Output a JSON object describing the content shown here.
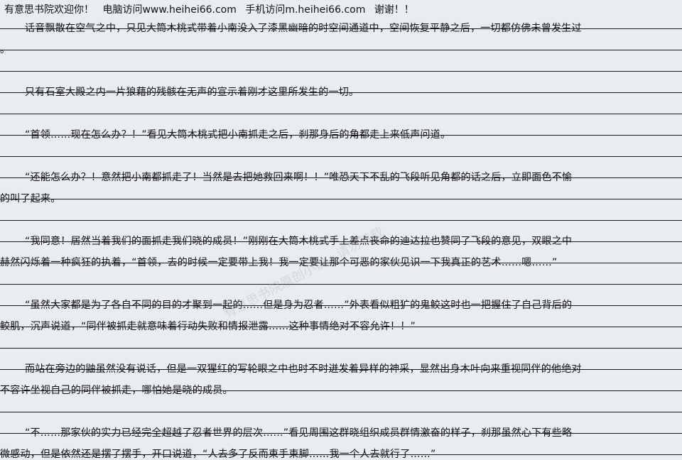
{
  "header": {
    "site": "有意思书院欢迎你！",
    "desktop": "电脑访问www.heihei66.com",
    "mobile": "手机访问m.heihei66.com",
    "thanks": "谢谢！！"
  },
  "paragraphs": [
    {
      "lines": [
        "话音飘散在空气之中，只见大筒木桃式带着小南没入了漆黑幽暗的时空间通道中，空间恢复平静之后，一切都仿佛未曾发生过",
        "。"
      ]
    },
    {
      "lines": [
        "只有石室大殿之内一片狼藉的残骸在无声的宣示着刚才这里所发生的一切。"
      ]
    },
    {
      "lines": [
        "“首领……现在怎么办？！”看见大筒木桃式把小南抓走之后，刹那身后的角都走上来低声问道。"
      ]
    },
    {
      "lines": [
        "“还能怎么办？！意然把小南都抓走了！当然是去把她救回来啊！！”唯恐天下不乱的飞段听见角都的话之后，立即面色不愉",
        "的叫了起来。"
      ]
    },
    {
      "lines": [
        "“我同意！居然当着我们的面抓走我们晓的成员！”刚刚在大筒木桃式手上差点丧命的迪达拉也赞同了飞段的意见，双眼之中",
        "赫然闪烁着一种疯狂的执着，“首领，去的时候一定要带上我！我一定要让那个可恶的家伙见识一下我真正的艺术……嗯……”"
      ]
    },
    {
      "lines": [
        "“虽然大家都是为了各自不同的目的才聚到一起的……但是身为忍者……”外表看似粗犷的鬼鲛这时也一把握住了自己背后的",
        "鲛肌，沉声说道，“同伴被抓走就意味着行动失败和情报泄露……这种事情绝对不容允许！！”"
      ]
    },
    {
      "lines": [
        "而站在旁边的鼬虽然没有说话，但是一双猩红的写轮眼之中也时不时迸发着异样的神采，显然出身木叶向来重视同伴的他绝对",
        "不容许坐视自己的同伴被抓走，哪怕她是晓的成员。"
      ]
    },
    {
      "lines": [
        "“不……那家伙的实力已经完全超越了忍者世界的层次……”看见周围这群晓组织成员群情激奋的样子，刹那虽然心下有些略",
        "微感动，但是依然还是摆了摆手，开口说道，“人去多了反而束手束脚……我一个人去就行了……”"
      ]
    }
  ],
  "watermark": "有意思书院原创小说，请勿转载"
}
